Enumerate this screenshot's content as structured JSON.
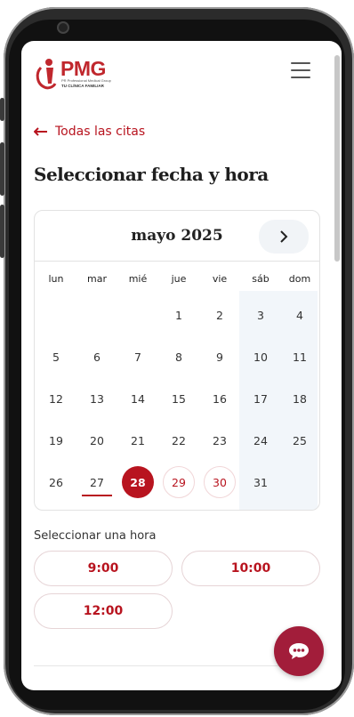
{
  "brand": {
    "name": "PMG",
    "subtitle_small": "PR Professional Medical Group",
    "tagline": "TU CLÍNICA FAMILIAR",
    "accent_color": "#b8141f",
    "chat_color": "#a21d3a"
  },
  "nav": {
    "back_label": "Todas las citas",
    "menu_icon": "hamburger-icon"
  },
  "page": {
    "title": "Seleccionar fecha y hora"
  },
  "calendar": {
    "month_label": "mayo 2025",
    "next_icon": "chevron-right-icon",
    "weekdays": [
      "lun",
      "mar",
      "mié",
      "jue",
      "vie",
      "sáb",
      "dom"
    ],
    "weeks": [
      [
        "",
        "",
        "",
        "1",
        "2",
        "3",
        "4"
      ],
      [
        "5",
        "6",
        "7",
        "8",
        "9",
        "10",
        "11"
      ],
      [
        "12",
        "13",
        "14",
        "15",
        "16",
        "17",
        "18"
      ],
      [
        "19",
        "20",
        "21",
        "22",
        "23",
        "24",
        "25"
      ],
      [
        "26",
        "27",
        "28",
        "29",
        "30",
        "31",
        ""
      ]
    ],
    "today": "27",
    "selected": "28",
    "available": [
      "29",
      "30"
    ]
  },
  "times": {
    "label": "Seleccionar una hora",
    "slots": [
      "9:00",
      "10:00",
      "12:00"
    ]
  },
  "chat": {
    "icon": "chat-bubble-icon"
  }
}
